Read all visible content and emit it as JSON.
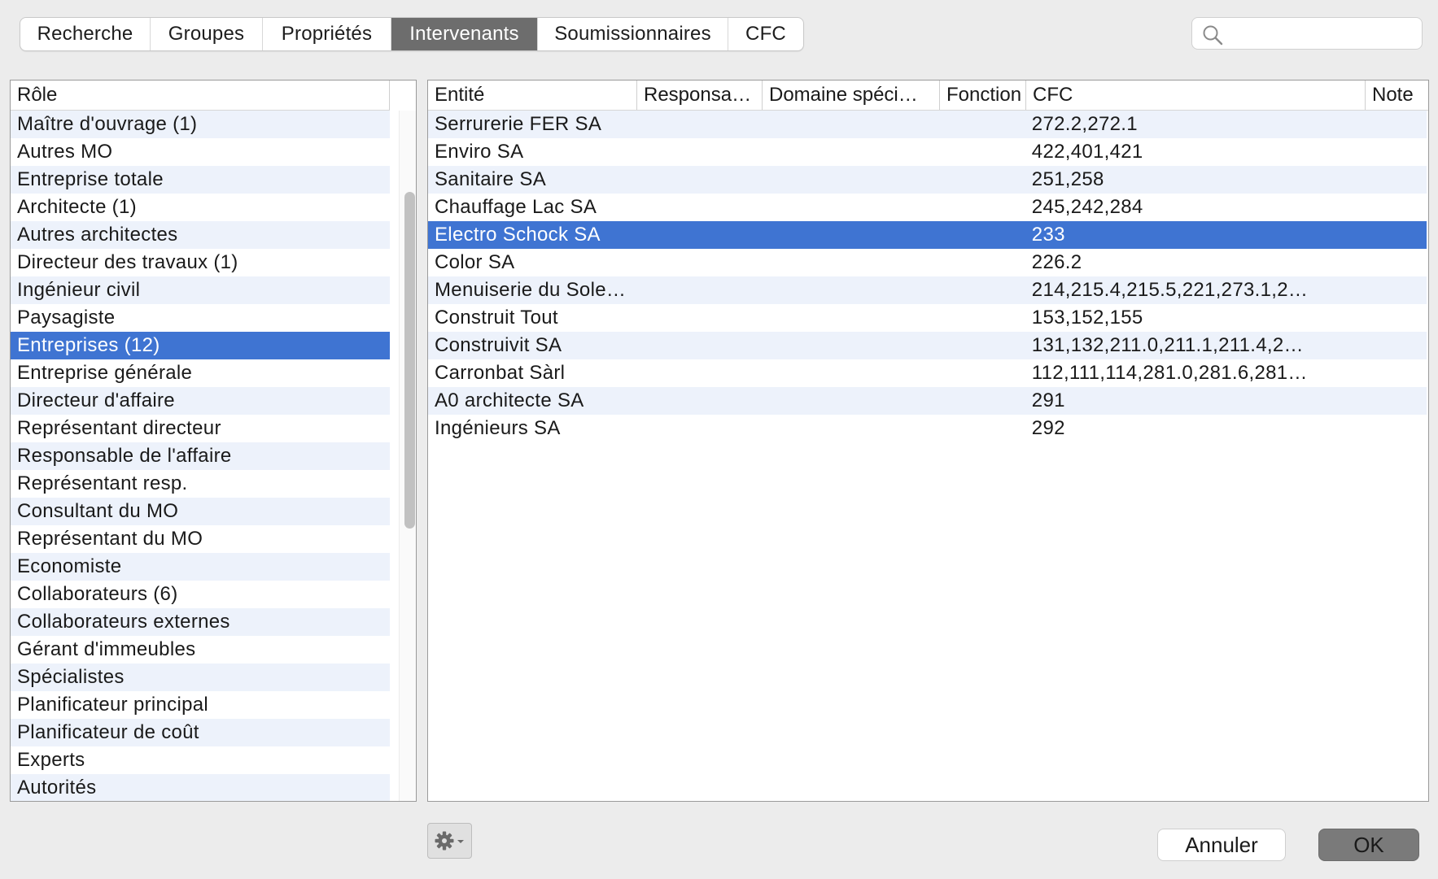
{
  "tabs": [
    {
      "label": "Recherche",
      "active": false
    },
    {
      "label": "Groupes",
      "active": false
    },
    {
      "label": "Propriétés",
      "active": false
    },
    {
      "label": "Intervenants",
      "active": true
    },
    {
      "label": "Soumissionnaires",
      "active": false
    },
    {
      "label": "CFC",
      "active": false
    }
  ],
  "search": {
    "value": "",
    "icon": "magnifier-icon"
  },
  "roles": {
    "header": "Rôle",
    "items": [
      "Maître d'ouvrage (1)",
      "Autres MO",
      "Entreprise totale",
      "Architecte (1)",
      "Autres architectes",
      "Directeur des travaux (1)",
      "Ingénieur civil",
      "Paysagiste",
      "Entreprises (12)",
      "Entreprise générale",
      "Directeur d'affaire",
      "Représentant directeur",
      "Responsable de l'affaire",
      "Représentant resp.",
      "Consultant du MO",
      "Représentant du MO",
      "Economiste",
      "Collaborateurs (6)",
      "Collaborateurs externes",
      "Gérant d'immeubles",
      "Spécialistes",
      "Planificateur principal",
      "Planificateur de coût",
      "Experts",
      "Autorités"
    ],
    "selected_index": 8
  },
  "entities": {
    "columns": [
      "Entité",
      "Responsa…",
      "Domaine spéci…",
      "Fonction",
      "CFC",
      "Note"
    ],
    "rows": [
      {
        "entite": "Serrurerie FER SA",
        "responsable": "",
        "domaine": "",
        "fonction": "",
        "cfc": "272.2,272.1",
        "note": ""
      },
      {
        "entite": "Enviro SA",
        "responsable": "",
        "domaine": "",
        "fonction": "",
        "cfc": "422,401,421",
        "note": ""
      },
      {
        "entite": "Sanitaire SA",
        "responsable": "",
        "domaine": "",
        "fonction": "",
        "cfc": "251,258",
        "note": ""
      },
      {
        "entite": "Chauffage Lac SA",
        "responsable": "",
        "domaine": "",
        "fonction": "",
        "cfc": "245,242,284",
        "note": ""
      },
      {
        "entite": "Electro Schock SA",
        "responsable": "",
        "domaine": "",
        "fonction": "",
        "cfc": "233",
        "note": ""
      },
      {
        "entite": "Color SA",
        "responsable": "",
        "domaine": "",
        "fonction": "",
        "cfc": "226.2",
        "note": ""
      },
      {
        "entite": "Menuiserie du Sole…",
        "responsable": "",
        "domaine": "",
        "fonction": "",
        "cfc": "214,215.4,215.5,221,273.1,2…",
        "note": ""
      },
      {
        "entite": "Construit Tout",
        "responsable": "",
        "domaine": "",
        "fonction": "",
        "cfc": "153,152,155",
        "note": ""
      },
      {
        "entite": "Construivit SA",
        "responsable": "",
        "domaine": "",
        "fonction": "",
        "cfc": "131,132,211.0,211.1,211.4,2…",
        "note": ""
      },
      {
        "entite": "Carronbat Sàrl",
        "responsable": "",
        "domaine": "",
        "fonction": "",
        "cfc": "112,111,114,281.0,281.6,281…",
        "note": ""
      },
      {
        "entite": "A0 architecte SA",
        "responsable": "",
        "domaine": "",
        "fonction": "",
        "cfc": "291",
        "note": ""
      },
      {
        "entite": "Ingénieurs SA",
        "responsable": "",
        "domaine": "",
        "fonction": "",
        "cfc": "292",
        "note": ""
      }
    ],
    "selected_index": 4
  },
  "footer": {
    "gear_icon": "gear-icon",
    "cancel_label": "Annuler",
    "ok_label": "OK"
  },
  "colors": {
    "selection": "#3f74d2",
    "alt_row": "#edf2fb",
    "active_tab": "#6d6d6d"
  }
}
